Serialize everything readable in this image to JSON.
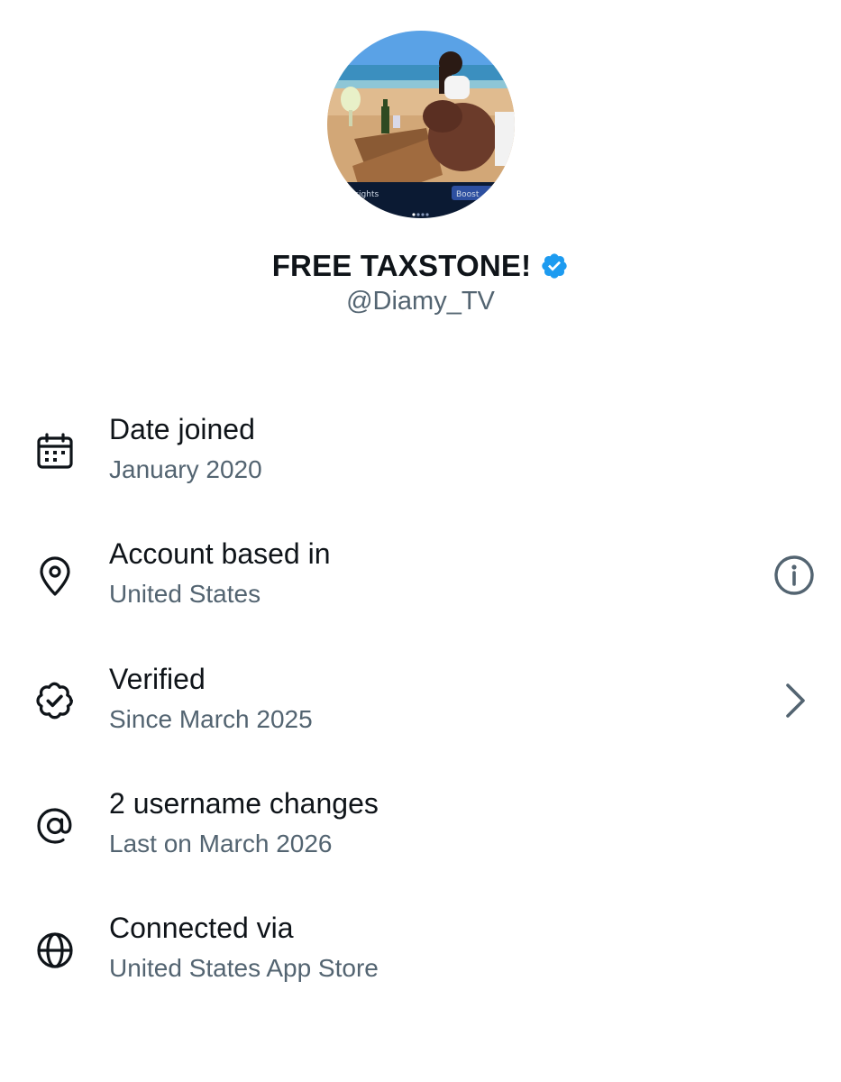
{
  "profile": {
    "display_name": "FREE TAXSTONE!",
    "handle": "@Diamy_TV",
    "verified": true,
    "avatar": {
      "description_icon": "profile-photo",
      "overlay_left_text": "Insights",
      "overlay_right_text": "Boost"
    }
  },
  "details": [
    {
      "id": "date-joined",
      "icon": "calendar-icon",
      "title": "Date joined",
      "value": "January 2020",
      "action": null
    },
    {
      "id": "account-based-in",
      "icon": "location-pin-icon",
      "title": "Account based in",
      "value": "United States",
      "action": "info-icon"
    },
    {
      "id": "verified",
      "icon": "verified-badge-outline-icon",
      "title": "Verified",
      "value": "Since March 2025",
      "action": "chevron-right-icon"
    },
    {
      "id": "username-changes",
      "icon": "at-sign-icon",
      "title": "2 username changes",
      "value": "Last on March 2026",
      "action": null
    },
    {
      "id": "connected-via",
      "icon": "globe-icon",
      "title": "Connected via",
      "value": "United States App Store",
      "action": null
    }
  ],
  "colors": {
    "text_primary": "#0f1419",
    "text_secondary": "#536471",
    "verified_blue": "#1d9bf0",
    "background": "#ffffff"
  }
}
